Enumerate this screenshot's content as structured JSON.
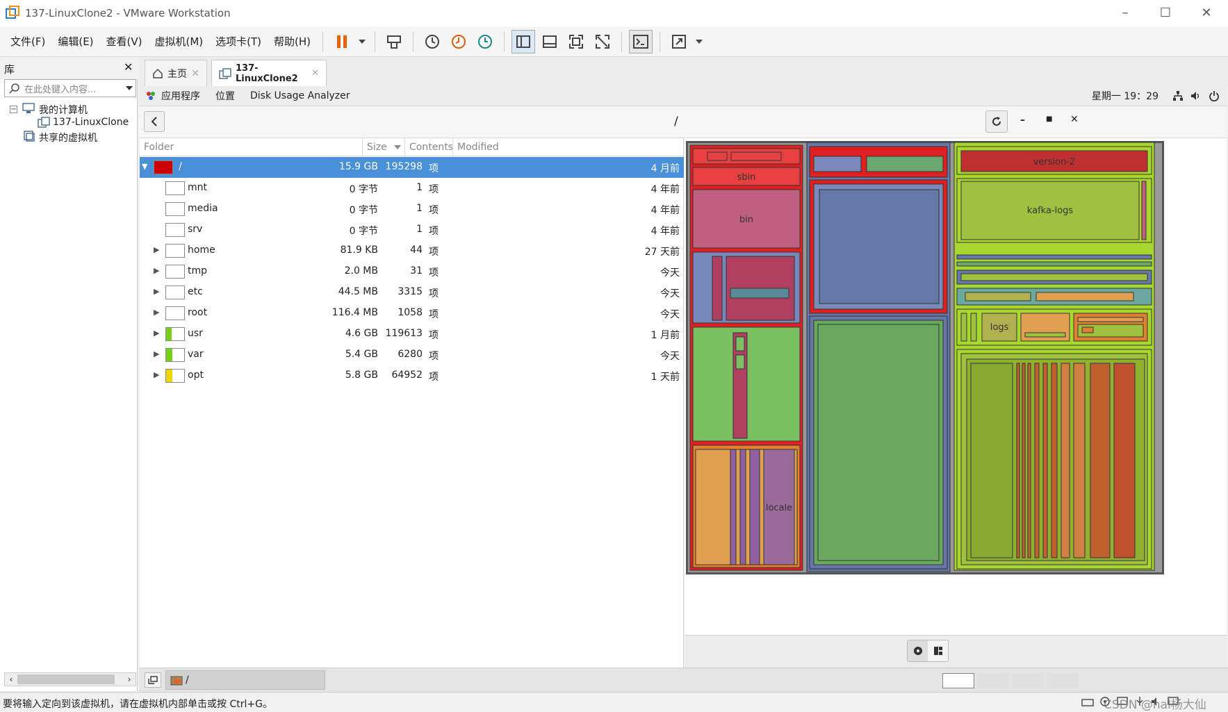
{
  "window": {
    "title": "137-LinuxClone2 - VMware Workstation"
  },
  "menu": [
    "文件(F)",
    "编辑(E)",
    "查看(V)",
    "虚拟机(M)",
    "选项卡(T)",
    "帮助(H)"
  ],
  "library": {
    "title": "库",
    "search_placeholder": "在此处键入内容...",
    "tree": {
      "my_computer": "我的计算机",
      "vm": "137-LinuxClone",
      "shared": "共享的虚拟机"
    }
  },
  "tabs": [
    {
      "label": "主页"
    },
    {
      "label": "137-LinuxClone2"
    }
  ],
  "guest": {
    "apps": "应用程序",
    "places": "位置",
    "app_name": "Disk Usage Analyzer",
    "clock": "星期一 19：29",
    "path": "/"
  },
  "columns": {
    "folder": "Folder",
    "size": "Size",
    "contents": "Contents",
    "modified": "Modified"
  },
  "xiang": "项",
  "rows": [
    {
      "name": "/",
      "size": "15.9 GB",
      "contents": "195298",
      "modified": "4 月前",
      "color": "#cc0000",
      "fill": 1.0,
      "expanded": true,
      "selected": true
    },
    {
      "name": "mnt",
      "size": "0 字节",
      "contents": "1",
      "modified": "4 年前",
      "color": "#ffffff",
      "fill": 0,
      "expander": false
    },
    {
      "name": "media",
      "size": "0 字节",
      "contents": "1",
      "modified": "4 年前",
      "color": "#ffffff",
      "fill": 0,
      "expander": false
    },
    {
      "name": "srv",
      "size": "0 字节",
      "contents": "1",
      "modified": "4 年前",
      "color": "#ffffff",
      "fill": 0,
      "expander": false
    },
    {
      "name": "home",
      "size": "81.9 KB",
      "contents": "44",
      "modified": "27 天前",
      "color": "#ffffff",
      "fill": 0,
      "expander": true
    },
    {
      "name": "tmp",
      "size": "2.0 MB",
      "contents": "31",
      "modified": "今天",
      "color": "#ffffff",
      "fill": 0,
      "expander": true
    },
    {
      "name": "etc",
      "size": "44.5 MB",
      "contents": "3315",
      "modified": "今天",
      "color": "#ffffff",
      "fill": 0,
      "expander": true
    },
    {
      "name": "root",
      "size": "116.4 MB",
      "contents": "1058",
      "modified": "今天",
      "color": "#ffffff",
      "fill": 0,
      "expander": true
    },
    {
      "name": "usr",
      "size": "4.6 GB",
      "contents": "119613",
      "modified": "1 月前",
      "color": "#73d216",
      "fill": 0.29,
      "expander": true
    },
    {
      "name": "var",
      "size": "5.4 GB",
      "contents": "6280",
      "modified": "今天",
      "color": "#73d216",
      "fill": 0.34,
      "expander": true
    },
    {
      "name": "opt",
      "size": "5.8 GB",
      "contents": "64952",
      "modified": "1 天前",
      "color": "#edd400",
      "fill": 0.36,
      "expander": true
    }
  ],
  "treemap_labels": {
    "sbin": "sbin",
    "bin": "bin",
    "locale": "locale",
    "version2": "version-2",
    "kafka": "kafka-logs",
    "logs": "logs"
  },
  "status": {
    "path": "/"
  },
  "bottom": {
    "hint": "要将输入定向到该虚拟机，请在虚拟机内部单击或按 Ctrl+G。",
    "watermark": "CSDN @hal杨大仙"
  }
}
